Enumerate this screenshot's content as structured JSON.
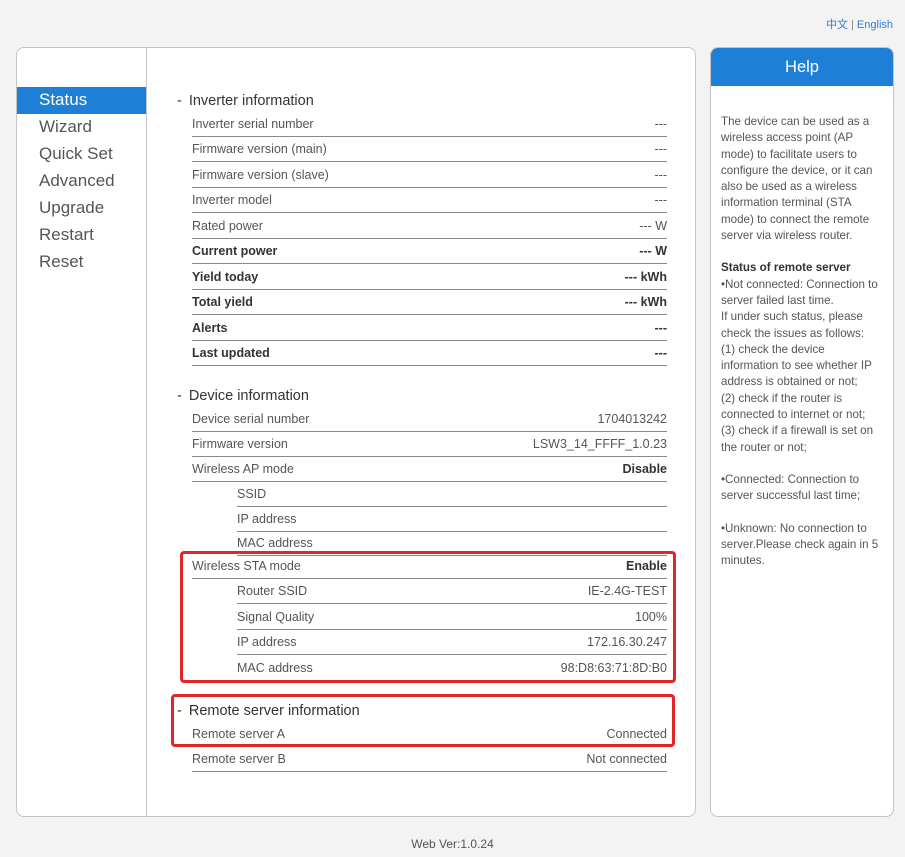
{
  "lang": {
    "chinese": "中文",
    "separator": "|",
    "english": "English"
  },
  "nav": {
    "items": [
      "Status",
      "Wizard",
      "Quick Set",
      "Advanced",
      "Upgrade",
      "Restart",
      "Reset"
    ]
  },
  "inverter": {
    "title": "Inverter information",
    "serial_label": "Inverter serial number",
    "serial_value": "---",
    "fw_main_label": "Firmware version (main)",
    "fw_main_value": "---",
    "fw_slave_label": "Firmware version (slave)",
    "fw_slave_value": "---",
    "model_label": "Inverter model",
    "model_value": "---",
    "rated_label": "Rated power",
    "rated_value": "--- W",
    "current_label": "Current power",
    "current_value": "--- W",
    "yield_today_label": "Yield today",
    "yield_today_value": "--- kWh",
    "total_yield_label": "Total yield",
    "total_yield_value": "--- kWh",
    "alerts_label": "Alerts",
    "alerts_value": "---",
    "last_updated_label": "Last updated",
    "last_updated_value": "---"
  },
  "device": {
    "title": "Device information",
    "serial_label": "Device serial number",
    "serial_value": "1704013242",
    "fw_label": "Firmware version",
    "fw_value": "LSW3_14_FFFF_1.0.23",
    "ap_label": "Wireless AP mode",
    "ap_value": "Disable",
    "ap_ssid_label": "SSID",
    "ap_ip_label": "IP address",
    "ap_mac_label": "MAC address",
    "sta_label": "Wireless STA mode",
    "sta_value": "Enable",
    "router_ssid_label": "Router SSID",
    "router_ssid_value": "IE-2.4G-TEST",
    "signal_label": "Signal Quality",
    "signal_value": "100%",
    "sta_ip_label": "IP address",
    "sta_ip_value": "172.16.30.247",
    "sta_mac_label": "MAC address",
    "sta_mac_value": "98:D8:63:71:8D:B0"
  },
  "remote": {
    "title": "Remote server information",
    "a_label": "Remote server A",
    "a_value": "Connected",
    "b_label": "Remote server B",
    "b_value": "Not connected"
  },
  "help": {
    "title": "Help",
    "intro": "The device can be used as a wireless access point (AP mode) to facilitate users to configure the device, or it can also be used as a wireless information terminal (STA mode) to connect the remote server via wireless router.",
    "status_title": "Status of remote server",
    "not_connected": "•Not connected: Connection to server failed last time.",
    "if_under": "If under such status, please check the issues as follows:",
    "check1": "(1) check the device information to see whether IP address is obtained or not;",
    "check2": "(2) check if the router is connected to internet or not;",
    "check3": "(3) check if a firewall is set on the router or not;",
    "connected": "•Connected: Connection to server successful last time;",
    "unknown": "•Unknown: No connection to server.Please check again in 5 minutes."
  },
  "footer": {
    "web_ver": "Web Ver:1.0.24"
  }
}
